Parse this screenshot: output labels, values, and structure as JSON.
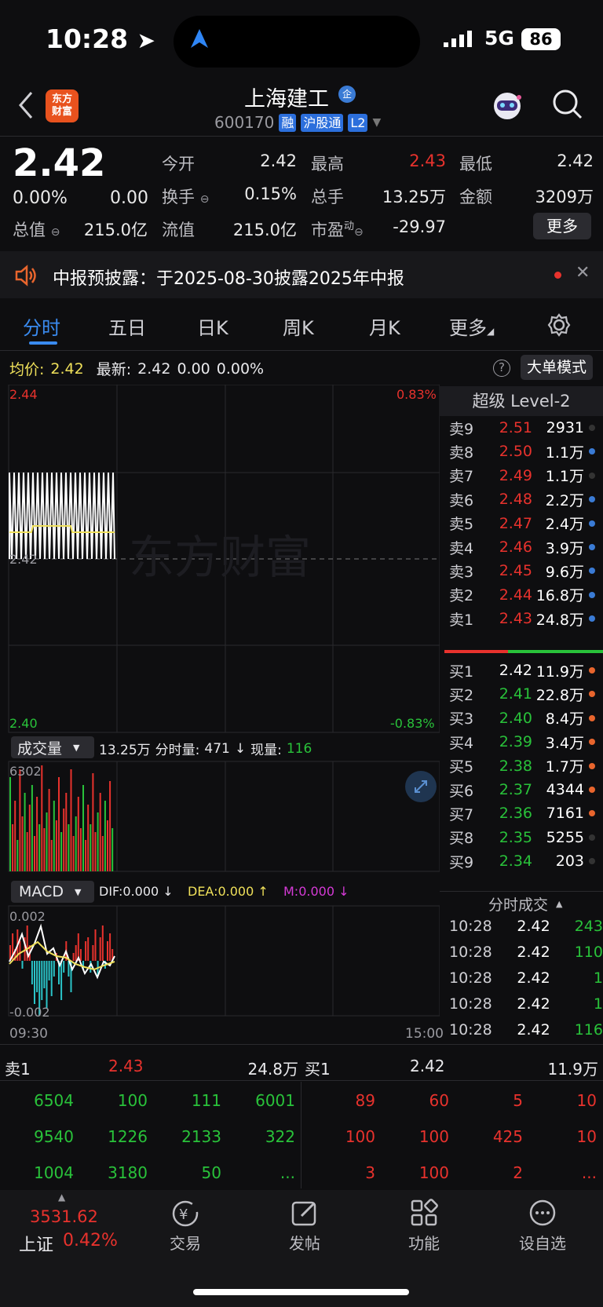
{
  "status": {
    "time": "10:28",
    "network": "5G",
    "battery": "86"
  },
  "header": {
    "logo_text_line1": "东方",
    "logo_text_line2": "财富",
    "stock_name": "上海建工",
    "enterprise_badge": "企",
    "code": "600170",
    "tags": [
      "融",
      "沪股通",
      "L2"
    ]
  },
  "quote": {
    "price": "2.42",
    "change_pct": "0.00%",
    "change": "0.00",
    "fields": [
      {
        "label": "今开",
        "value": "2.42",
        "color": "white"
      },
      {
        "label": "最高",
        "value": "2.43",
        "color": "red"
      },
      {
        "label": "最低",
        "value": "2.42",
        "color": "white"
      },
      {
        "label": "换手",
        "value": "0.15%",
        "color": "white"
      },
      {
        "label": "总手",
        "value": "13.25万",
        "color": "white"
      },
      {
        "label": "金额",
        "value": "3209万",
        "color": "white"
      },
      {
        "label": "总值",
        "value": "215.0亿",
        "color": "white"
      },
      {
        "label": "流值",
        "value": "215.0亿",
        "color": "white"
      },
      {
        "label": "市盈",
        "value": "-29.97",
        "color": "white"
      }
    ],
    "pe_sup": "动",
    "more_label": "更多"
  },
  "notice": {
    "text": "中报预披露：于2025-08-30披露2025年中报"
  },
  "tabs": [
    "分时",
    "五日",
    "日K",
    "周K",
    "月K",
    "更多"
  ],
  "intraday": {
    "avg_label": "均价:",
    "avg": "2.42",
    "latest_label": "最新:",
    "latest": "2.42",
    "chg": "0.00",
    "pct": "0.00%",
    "big_order_label": "大单模式",
    "y_top": "2.44",
    "y_mid": "2.42",
    "y_bot": "2.40",
    "pct_top": "0.83%",
    "pct_bot": "-0.83%",
    "watermark": "东方财富"
  },
  "volume": {
    "selector": "成交量",
    "total": "13.25万",
    "fs_label": "分时量:",
    "fs_value": "471",
    "arrow": "↓",
    "now_label": "现量:",
    "now_value": "116",
    "max": "6302"
  },
  "macd": {
    "selector": "MACD",
    "dif": "DIF:0.000 ↓",
    "dea": "DEA:0.000 ↑",
    "m": "M:0.000 ↓",
    "top": "0.002",
    "bot": "-0.002",
    "t_start": "09:30",
    "t_end": "15:00"
  },
  "level2": {
    "title": "超级 Level-2",
    "asks": [
      {
        "label": "卖9",
        "price": "2.51",
        "vol": "2931",
        "dot": "#333"
      },
      {
        "label": "卖8",
        "price": "2.50",
        "vol": "1.1万",
        "dot": "#3a7bd5"
      },
      {
        "label": "卖7",
        "price": "2.49",
        "vol": "1.1万",
        "dot": "#333"
      },
      {
        "label": "卖6",
        "price": "2.48",
        "vol": "2.2万",
        "dot": "#3a7bd5"
      },
      {
        "label": "卖5",
        "price": "2.47",
        "vol": "2.4万",
        "dot": "#3a7bd5"
      },
      {
        "label": "卖4",
        "price": "2.46",
        "vol": "3.9万",
        "dot": "#3a7bd5"
      },
      {
        "label": "卖3",
        "price": "2.45",
        "vol": "9.6万",
        "dot": "#3a7bd5"
      },
      {
        "label": "卖2",
        "price": "2.44",
        "vol": "16.8万",
        "dot": "#3a7bd5"
      },
      {
        "label": "卖1",
        "price": "2.43",
        "vol": "24.8万",
        "dot": "#3a7bd5"
      }
    ],
    "bids": [
      {
        "label": "买1",
        "price": "2.42",
        "vol": "11.9万",
        "color": "white",
        "dot": "#e8652d"
      },
      {
        "label": "买2",
        "price": "2.41",
        "vol": "22.8万",
        "color": "green",
        "dot": "#e8652d"
      },
      {
        "label": "买3",
        "price": "2.40",
        "vol": "8.4万",
        "color": "green",
        "dot": "#e8652d"
      },
      {
        "label": "买4",
        "price": "2.39",
        "vol": "3.4万",
        "color": "green",
        "dot": "#e8652d"
      },
      {
        "label": "买5",
        "price": "2.38",
        "vol": "1.7万",
        "color": "green",
        "dot": "#e8652d"
      },
      {
        "label": "买6",
        "price": "2.37",
        "vol": "4344",
        "color": "green",
        "dot": "#e8652d"
      },
      {
        "label": "买7",
        "price": "2.36",
        "vol": "7161",
        "color": "green",
        "dot": "#e8652d"
      },
      {
        "label": "买8",
        "price": "2.35",
        "vol": "5255",
        "color": "green",
        "dot": "#333"
      },
      {
        "label": "买9",
        "price": "2.34",
        "vol": "203",
        "color": "green",
        "dot": "#333"
      }
    ]
  },
  "trades": {
    "title": "分时成交",
    "rows": [
      {
        "time": "10:28",
        "price": "2.42",
        "vol": "243"
      },
      {
        "time": "10:28",
        "price": "2.42",
        "vol": "110"
      },
      {
        "time": "10:28",
        "price": "2.42",
        "vol": "1"
      },
      {
        "time": "10:28",
        "price": "2.42",
        "vol": "1"
      },
      {
        "time": "10:28",
        "price": "2.42",
        "vol": "116"
      }
    ]
  },
  "queue": {
    "sell_label": "卖1",
    "sell_price": "2.43",
    "sell_vol": "24.8万",
    "buy_label": "买1",
    "buy_price": "2.42",
    "buy_vol": "11.9万",
    "sell_rows": [
      [
        "6504",
        "100",
        "111",
        "6001"
      ],
      [
        "9540",
        "1226",
        "2133",
        "322"
      ],
      [
        "1004",
        "3180",
        "50",
        "..."
      ]
    ],
    "buy_rows": [
      [
        "89",
        "60",
        "5",
        "10"
      ],
      [
        "100",
        "100",
        "425",
        "10"
      ],
      [
        "3",
        "100",
        "2",
        "..."
      ]
    ]
  },
  "nav": {
    "index_value": "3531.62",
    "index_name": "上证",
    "index_pct": "0.42%",
    "items": [
      "交易",
      "发帖",
      "功能",
      "设自选"
    ]
  }
}
